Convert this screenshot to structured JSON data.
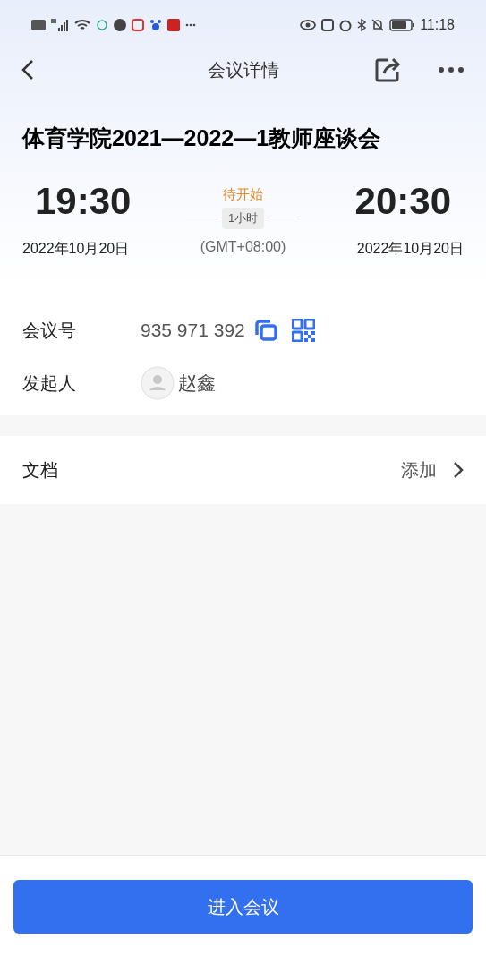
{
  "status_bar": {
    "time": "11:18"
  },
  "nav": {
    "title": "会议详情"
  },
  "meeting": {
    "title": "体育学院2021—2022—1教师座谈会",
    "start_time": "19:30",
    "start_date": "2022年10月20日",
    "state": "待开始",
    "duration": "1小时",
    "timezone": "(GMT+08:00)",
    "end_time": "20:30",
    "end_date": "2022年10月20日"
  },
  "details": [
    {
      "kind": "number",
      "label": "会议号",
      "value": "935 971 392"
    },
    {
      "kind": "person",
      "label": "发起人",
      "value": "赵鑫"
    }
  ],
  "documents": {
    "label": "文档",
    "action": "添加"
  },
  "join_button": "进入会议"
}
